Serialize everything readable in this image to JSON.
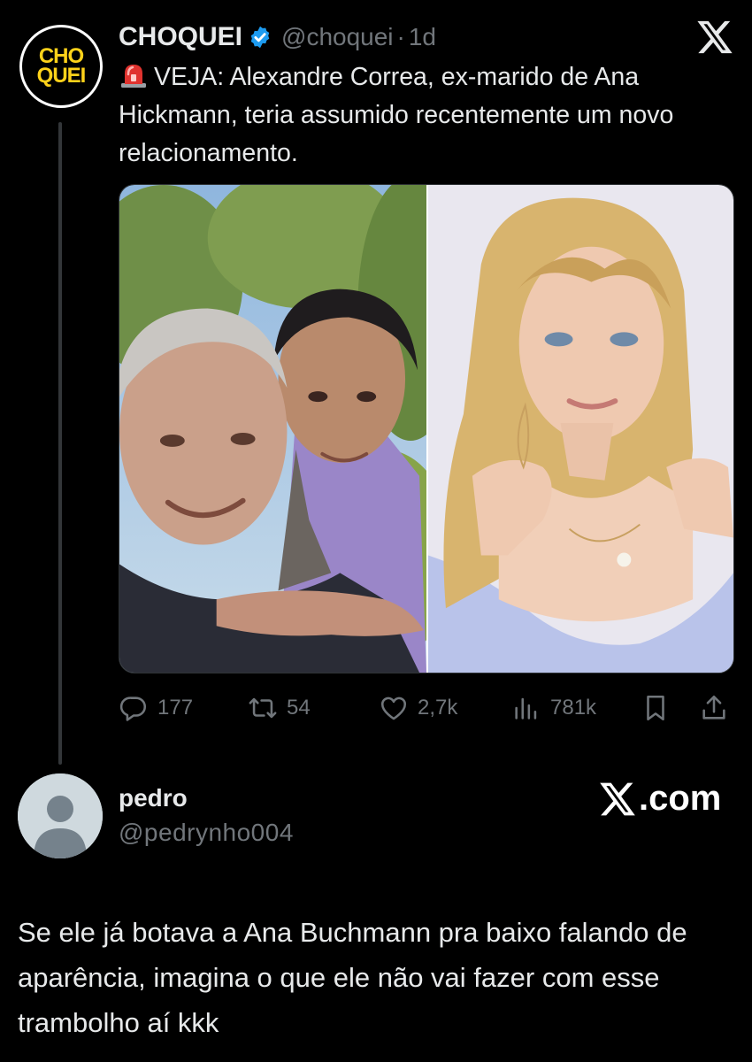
{
  "quoted_tweet": {
    "avatar_logo": [
      "CHO",
      "QUEI"
    ],
    "author_name": "CHOQUEI",
    "verified": true,
    "handle": "@choquei",
    "separator": "·",
    "time": "1d",
    "siren_icon": "police-siren-emoji",
    "text": "VEJA: Alexandre Correa, ex-marido de Ana Hickmann, teria assumido recentemente um novo relacionamento.",
    "media": {
      "left_photo": "selfie-man-and-woman-outdoors",
      "right_photo": "blonde-woman-portrait"
    },
    "stats": {
      "replies": "177",
      "reposts": "54",
      "likes": "2,7k",
      "views": "781k"
    },
    "icons": [
      "reply-icon",
      "repost-icon",
      "like-icon",
      "views-icon",
      "bookmark-icon",
      "share-icon",
      "x-close-icon"
    ]
  },
  "reply": {
    "name": "pedro",
    "handle": "@pedrynho004",
    "brand": ".com",
    "text": "Se ele já botava a Ana Buchmann pra baixo falando de aparência, imagina o que ele não vai fazer com esse trambolho aí kkk"
  },
  "colors": {
    "background": "#000000",
    "text": "#e7e9ea",
    "muted": "#71767b",
    "verified": "#1d9bf0",
    "logo_yellow": "#ffd21a"
  }
}
